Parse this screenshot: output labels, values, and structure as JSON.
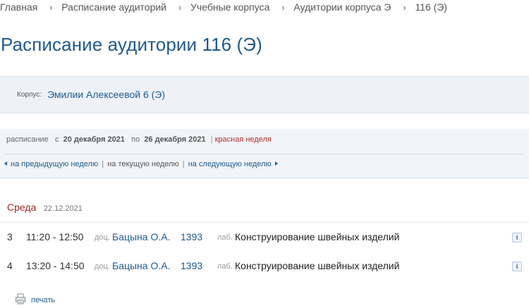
{
  "breadcrumb": {
    "items": [
      "Главная",
      "Расписание аудиторий",
      "Учебные корпуса",
      "Аудитории корпуса Э"
    ],
    "current": "116 (Э)",
    "separator": "›"
  },
  "page": {
    "title": "Расписание аудитории 116 (Э)"
  },
  "building": {
    "label": "Корпус:",
    "name": "Эмилии Алексеевой 6 (Э)"
  },
  "period": {
    "label": "расписание",
    "from_word": "с",
    "from_date": "20 декабря 2021",
    "to_word": "по",
    "to_date": "26 декабря 2021",
    "week_type": "красная неделя",
    "separator": "|"
  },
  "week_nav": {
    "prev": "на предыдущую неделю",
    "current": "на текущую неделю",
    "next": "на следующую неделю",
    "separator": "|"
  },
  "day": {
    "name": "Среда",
    "date": "22.12.2021",
    "lessons": [
      {
        "number": "3",
        "time": "11:20 - 12:50",
        "position": "доц.",
        "teacher": "Бацына О.А.",
        "room": "1393",
        "type": "лаб.",
        "subject": "Конструирование швейных изделий",
        "info_icon": "i"
      },
      {
        "number": "4",
        "time": "13:20 - 14:50",
        "position": "доц.",
        "teacher": "Бацына О.А.",
        "room": "1393",
        "type": "лаб.",
        "subject": "Конструирование швейных изделий",
        "info_icon": "i"
      }
    ]
  },
  "print": {
    "label": "печать",
    "icon": "printer-icon"
  },
  "colors": {
    "link": "#1e5a8e",
    "day_name": "#9c2a26",
    "red_week": "#b0302a",
    "panel_bg": "#eef2f8"
  }
}
